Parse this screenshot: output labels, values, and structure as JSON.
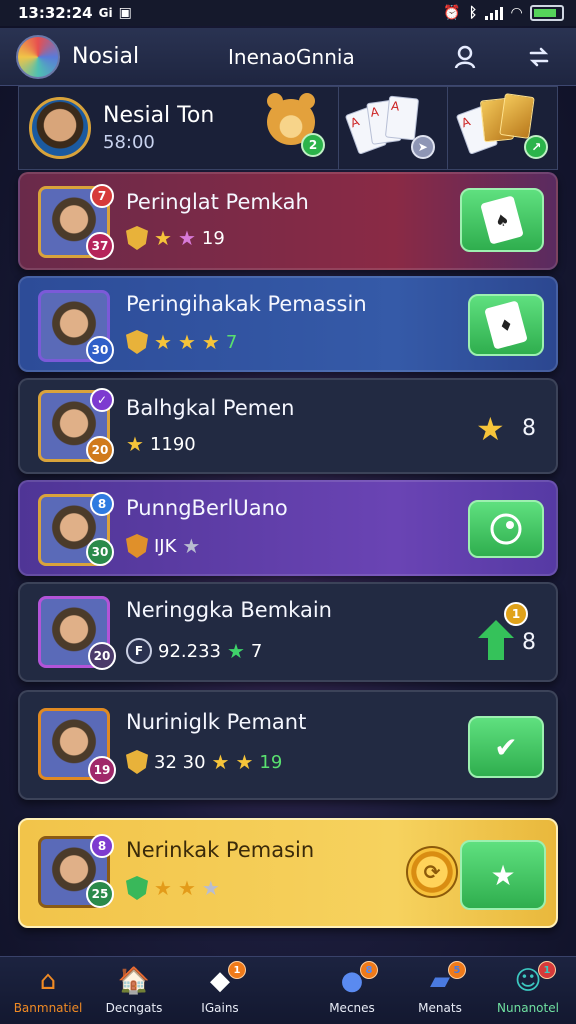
{
  "status_bar": {
    "time": "13:32:24",
    "carrier": "Gi"
  },
  "header": {
    "app_name": "Nosial",
    "title": "InenaoGnnia"
  },
  "profile": {
    "name": "Nesial Ton",
    "coins": "58:00",
    "teddy_badge": "2"
  },
  "list": [
    {
      "title": "Peringlat Pemkah",
      "sub": "19",
      "level": "37",
      "top_badge": "7",
      "action": "card"
    },
    {
      "title": "Peringihakak Pemassin",
      "sub": "7",
      "level": "30",
      "top_badge": "",
      "action": "card"
    },
    {
      "title": "Balhgkal Pemen",
      "sub": "1190",
      "level": "20",
      "top_badge": "✓",
      "value": "8"
    },
    {
      "title": "PunngBerlUano",
      "sub": "IJK",
      "level": "30",
      "top_badge": "8",
      "action": "record"
    },
    {
      "title": "Neringgka Bemkain",
      "sub": "92.233",
      "sub2": "7",
      "level": "20",
      "top_badge": "",
      "value": "8",
      "mini_badge": "1"
    },
    {
      "title": "Nuriniglk Pemant",
      "sub": "32 30",
      "sub2": "19",
      "level": "19",
      "top_badge": "",
      "action": "check"
    },
    {
      "title": "Nerinkak Pemasin",
      "sub": "",
      "level": "25",
      "top_badge": "8",
      "action": "star"
    }
  ],
  "row_letter_badge": "F",
  "bottom_nav": [
    {
      "label": "Banmnatiel",
      "badge": ""
    },
    {
      "label": "Decngats",
      "badge": ""
    },
    {
      "label": "IGains",
      "badge": "1"
    },
    {
      "label": "Mecnes",
      "badge": "8"
    },
    {
      "label": "Menats",
      "badge": "5"
    },
    {
      "label": "Nunanotel",
      "badge": "1"
    }
  ],
  "colors": {
    "accent_green": "#2fae4e",
    "row1": "#6e2a4a",
    "row2": "#2f4f9a",
    "row_dark": "#222a42",
    "row_purple": "#5a3b9e",
    "row_gold": "#f2c44a",
    "nav_active": "#f08a24"
  },
  "icons": [
    "search-icon",
    "refresh-icon",
    "home-icon",
    "shop-icon",
    "games-icon",
    "messages-icon",
    "chat-icon",
    "profile-icon"
  ]
}
